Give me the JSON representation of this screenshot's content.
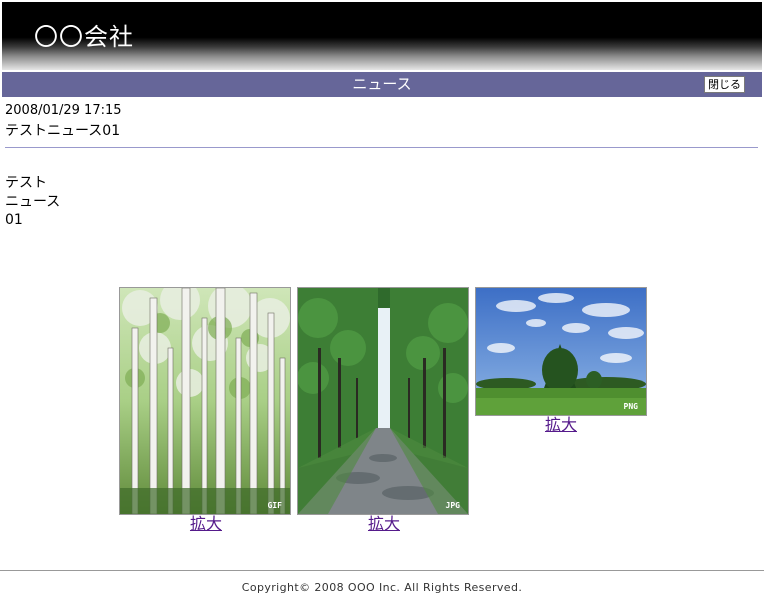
{
  "header": {
    "company_name": "〇〇会社"
  },
  "titlebar": {
    "title": "ニュース",
    "close_label": "閉じる"
  },
  "news": {
    "datetime": "2008/01/29 17:15",
    "title": "テストニュース01",
    "body_lines": [
      "テスト",
      "ニュース",
      "01"
    ]
  },
  "images": [
    {
      "format": "GIF",
      "enlarge_label": "拡大"
    },
    {
      "format": "JPG",
      "enlarge_label": "拡大"
    },
    {
      "format": "PNG",
      "enlarge_label": "拡大"
    }
  ],
  "footer": {
    "copyright": "Copyright© 2008 OOO Inc. All Rights Reserved."
  },
  "colors": {
    "titlebar": "#666699",
    "link": "#551a8b",
    "rule": "#9999cc"
  }
}
